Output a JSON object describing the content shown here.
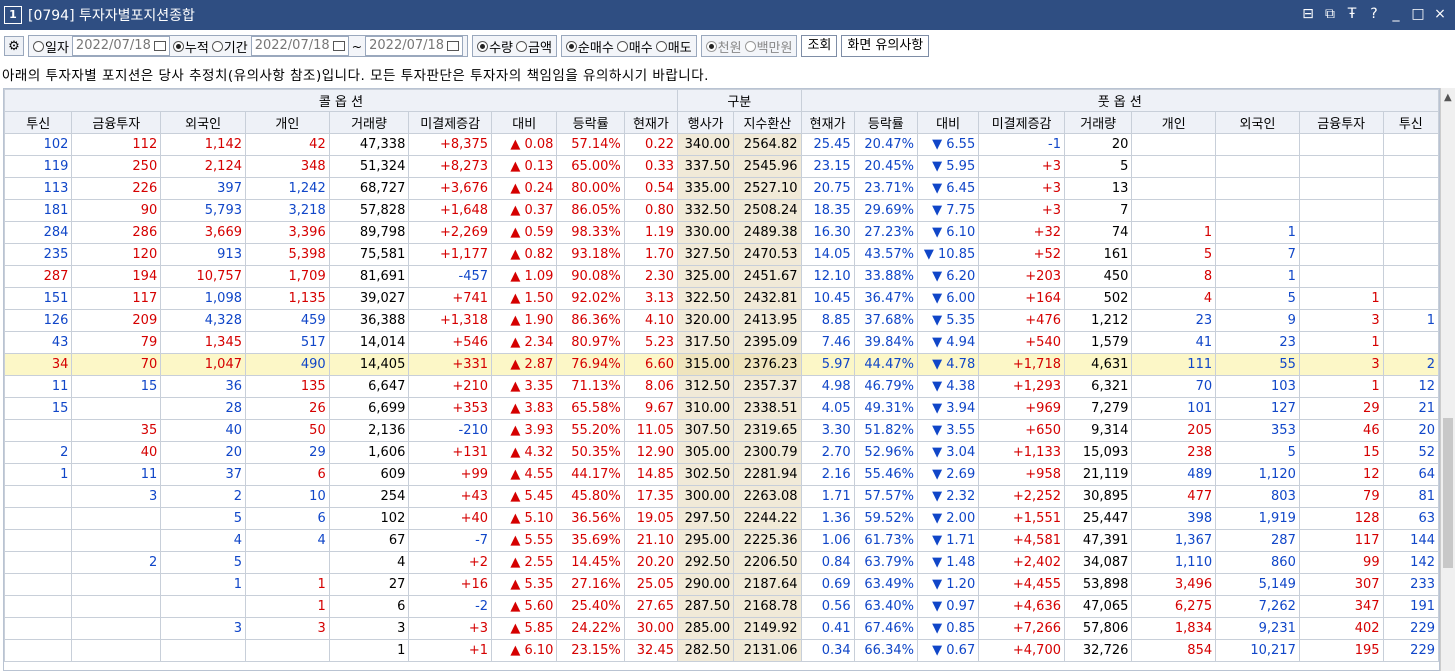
{
  "window": {
    "num": "1",
    "title": "[0794] 투자자별포지션종합",
    "controls": [
      "restore-icon",
      "copy-icon",
      "pin-icon",
      "help-icon",
      "minimize-icon",
      "maximize-icon",
      "close-icon"
    ],
    "control_glyphs": [
      "⊟",
      "⧉",
      "Ŧ",
      "?",
      "_",
      "□",
      "×"
    ]
  },
  "toolbar": {
    "gear": "⚙",
    "radio_daily": "일자",
    "date1": "2022/07/18",
    "radio_cumulative": "누적",
    "radio_period": "기간",
    "date_from": "2022/07/18",
    "tilde": "~",
    "date_to": "2022/07/18",
    "radio_qty": "수량",
    "radio_amount": "금액",
    "radio_net": "순매수",
    "radio_buy": "매수",
    "radio_sell": "매도",
    "radio_thousand": "천원",
    "radio_million": "백만원",
    "query_button": "조회",
    "notice_button": "화면 유의사항"
  },
  "notice": "아래의 투자자별 포지션은 당사 추정치(유의사항 참조)입니다. 모든 투자판단은 투자자의 책임임을 유의하시기 바랍니다.",
  "table": {
    "group_headers": {
      "call": "콜 옵 션",
      "mid": "구분",
      "put": "풋 옵 션"
    },
    "columns": [
      "투신",
      "금융투자",
      "외국인",
      "개인",
      "거래량",
      "미결제증감",
      "대비",
      "등락률",
      "현재가",
      "행사가",
      "지수환산",
      "현재가",
      "등락률",
      "대비",
      "미결제증감",
      "거래량",
      "개인",
      "외국인",
      "금융투자",
      "투신"
    ],
    "rows": [
      [
        "102",
        "112",
        "1,142",
        "42",
        "47,338",
        "+8,375",
        "0.08",
        "57.14%",
        "0.22",
        "340.00",
        "2564.82",
        "25.45",
        "20.47%",
        "6.55",
        "-1",
        "20",
        "",
        "",
        "",
        ""
      ],
      [
        "119",
        "250",
        "2,124",
        "348",
        "51,324",
        "+8,273",
        "0.13",
        "65.00%",
        "0.33",
        "337.50",
        "2545.96",
        "23.15",
        "20.45%",
        "5.95",
        "+3",
        "5",
        "",
        "",
        "",
        ""
      ],
      [
        "113",
        "226",
        "397",
        "1,242",
        "68,727",
        "+3,676",
        "0.24",
        "80.00%",
        "0.54",
        "335.00",
        "2527.10",
        "20.75",
        "23.71%",
        "6.45",
        "+3",
        "13",
        "",
        "",
        "",
        ""
      ],
      [
        "181",
        "90",
        "5,793",
        "3,218",
        "57,828",
        "+1,648",
        "0.37",
        "86.05%",
        "0.80",
        "332.50",
        "2508.24",
        "18.35",
        "29.69%",
        "7.75",
        "+3",
        "7",
        "",
        "",
        "",
        ""
      ],
      [
        "284",
        "286",
        "3,669",
        "3,396",
        "89,798",
        "+2,269",
        "0.59",
        "98.33%",
        "1.19",
        "330.00",
        "2489.38",
        "16.30",
        "27.23%",
        "6.10",
        "+32",
        "74",
        "1",
        "1",
        "",
        ""
      ],
      [
        "235",
        "120",
        "913",
        "5,398",
        "75,581",
        "+1,177",
        "0.82",
        "93.18%",
        "1.70",
        "327.50",
        "2470.53",
        "14.05",
        "43.57%",
        "10.85",
        "+52",
        "161",
        "5",
        "7",
        "",
        ""
      ],
      [
        "287",
        "194",
        "10,757",
        "1,709",
        "81,691",
        "-457",
        "1.09",
        "90.08%",
        "2.30",
        "325.00",
        "2451.67",
        "12.10",
        "33.88%",
        "6.20",
        "+203",
        "450",
        "8",
        "1",
        "",
        ""
      ],
      [
        "151",
        "117",
        "1,098",
        "1,135",
        "39,027",
        "+741",
        "1.50",
        "92.02%",
        "3.13",
        "322.50",
        "2432.81",
        "10.45",
        "36.47%",
        "6.00",
        "+164",
        "502",
        "4",
        "5",
        "1",
        ""
      ],
      [
        "126",
        "209",
        "4,328",
        "459",
        "36,388",
        "+1,318",
        "1.90",
        "86.36%",
        "4.10",
        "320.00",
        "2413.95",
        "8.85",
        "37.68%",
        "5.35",
        "+476",
        "1,212",
        "23",
        "9",
        "3",
        "1"
      ],
      [
        "43",
        "79",
        "1,345",
        "517",
        "14,014",
        "+546",
        "2.34",
        "80.97%",
        "5.23",
        "317.50",
        "2395.09",
        "7.46",
        "39.84%",
        "4.94",
        "+540",
        "1,579",
        "41",
        "23",
        "1",
        ""
      ],
      [
        "34",
        "70",
        "1,047",
        "490",
        "14,405",
        "+331",
        "2.87",
        "76.94%",
        "6.60",
        "315.00",
        "2376.23",
        "5.97",
        "44.47%",
        "4.78",
        "+1,718",
        "4,631",
        "111",
        "55",
        "3",
        "2"
      ],
      [
        "11",
        "15",
        "36",
        "135",
        "6,647",
        "+210",
        "3.35",
        "71.13%",
        "8.06",
        "312.50",
        "2357.37",
        "4.98",
        "46.79%",
        "4.38",
        "+1,293",
        "6,321",
        "70",
        "103",
        "1",
        "12"
      ],
      [
        "15",
        "",
        "28",
        "26",
        "6,699",
        "+353",
        "3.83",
        "65.58%",
        "9.67",
        "310.00",
        "2338.51",
        "4.05",
        "49.31%",
        "3.94",
        "+969",
        "7,279",
        "101",
        "127",
        "29",
        "21"
      ],
      [
        "",
        "35",
        "40",
        "50",
        "2,136",
        "-210",
        "3.93",
        "55.20%",
        "11.05",
        "307.50",
        "2319.65",
        "3.30",
        "51.82%",
        "3.55",
        "+650",
        "9,314",
        "205",
        "353",
        "46",
        "20"
      ],
      [
        "2",
        "40",
        "20",
        "29",
        "1,606",
        "+131",
        "4.32",
        "50.35%",
        "12.90",
        "305.00",
        "2300.79",
        "2.70",
        "52.96%",
        "3.04",
        "+1,133",
        "15,093",
        "238",
        "5",
        "15",
        "52"
      ],
      [
        "1",
        "11",
        "37",
        "6",
        "609",
        "+99",
        "4.55",
        "44.17%",
        "14.85",
        "302.50",
        "2281.94",
        "2.16",
        "55.46%",
        "2.69",
        "+958",
        "21,119",
        "489",
        "1,120",
        "12",
        "64"
      ],
      [
        "",
        "3",
        "2",
        "10",
        "254",
        "+43",
        "5.45",
        "45.80%",
        "17.35",
        "300.00",
        "2263.08",
        "1.71",
        "57.57%",
        "2.32",
        "+2,252",
        "30,895",
        "477",
        "803",
        "79",
        "81"
      ],
      [
        "",
        "",
        "5",
        "6",
        "102",
        "+40",
        "5.10",
        "36.56%",
        "19.05",
        "297.50",
        "2244.22",
        "1.36",
        "59.52%",
        "2.00",
        "+1,551",
        "25,447",
        "398",
        "1,919",
        "128",
        "63"
      ],
      [
        "",
        "",
        "4",
        "4",
        "67",
        "-7",
        "5.55",
        "35.69%",
        "21.10",
        "295.00",
        "2225.36",
        "1.06",
        "61.73%",
        "1.71",
        "+4,581",
        "47,391",
        "1,367",
        "287",
        "117",
        "144"
      ],
      [
        "",
        "2",
        "5",
        "",
        "4",
        "+2",
        "2.55",
        "14.45%",
        "20.20",
        "292.50",
        "2206.50",
        "0.84",
        "63.79%",
        "1.48",
        "+2,402",
        "34,087",
        "1,110",
        "860",
        "99",
        "142"
      ],
      [
        "",
        "",
        "1",
        "1",
        "27",
        "+16",
        "5.35",
        "27.16%",
        "25.05",
        "290.00",
        "2187.64",
        "0.69",
        "63.49%",
        "1.20",
        "+4,455",
        "53,898",
        "3,496",
        "5,149",
        "307",
        "233"
      ],
      [
        "",
        "",
        "",
        "1",
        "6",
        "-2",
        "5.60",
        "25.40%",
        "27.65",
        "287.50",
        "2168.78",
        "0.56",
        "63.40%",
        "0.97",
        "+4,636",
        "47,065",
        "6,275",
        "7,262",
        "347",
        "191"
      ],
      [
        "",
        "",
        "3",
        "3",
        "3",
        "+3",
        "5.85",
        "24.22%",
        "30.00",
        "285.00",
        "2149.92",
        "0.41",
        "67.46%",
        "0.85",
        "+7,266",
        "57,806",
        "1,834",
        "9,231",
        "402",
        "229"
      ],
      [
        "",
        "",
        "",
        "",
        "1",
        "+1",
        "6.10",
        "23.15%",
        "32.45",
        "282.50",
        "2131.06",
        "0.34",
        "66.34%",
        "0.67",
        "+4,700",
        "32,726",
        "854",
        "10,217",
        "195",
        "229"
      ]
    ],
    "highlight_row_index": 10,
    "colors": {
      "red": "#d50000",
      "blue": "#1046c8",
      "highlight": "#fcf7c7",
      "mid_band": "#f1ead8"
    }
  }
}
